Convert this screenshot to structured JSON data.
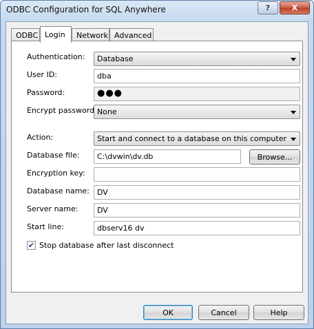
{
  "window": {
    "title": "ODBC Configuration for SQL Anywhere",
    "help_glyph": "?",
    "close_glyph": "X"
  },
  "tabs": [
    {
      "label": "ODBC",
      "active": false
    },
    {
      "label": "Login",
      "active": true
    },
    {
      "label": "Network",
      "active": false
    },
    {
      "label": "Advanced",
      "active": false
    }
  ],
  "login": {
    "authentication": {
      "label": "Authentication:",
      "value": "Database"
    },
    "user_id": {
      "label": "User ID:",
      "value": "dba"
    },
    "password": {
      "label": "Password:",
      "value": "●●●"
    },
    "encrypt_password": {
      "label": "Encrypt password:",
      "value": "None"
    },
    "action": {
      "label": "Action:",
      "value": "Start and connect to a database on this computer"
    },
    "database_file": {
      "label": "Database file:",
      "value": "C:\\dvwin\\dv.db"
    },
    "browse_label": "Browse...",
    "encryption_key": {
      "label": "Encryption key:",
      "value": ""
    },
    "database_name": {
      "label": "Database name:",
      "value": "DV"
    },
    "server_name": {
      "label": "Server name:",
      "value": "DV"
    },
    "start_line": {
      "label": "Start line:",
      "value": "dbserv16 dv"
    },
    "stop_db": {
      "label": "Stop database after last disconnect",
      "checked": true,
      "glyph": "✔"
    }
  },
  "footer": {
    "ok_label": "OK",
    "cancel_label": "Cancel",
    "help_label": "Help"
  },
  "colors": {
    "frame": "#bcd1ea",
    "default_button_border": "#3c7fb1"
  }
}
